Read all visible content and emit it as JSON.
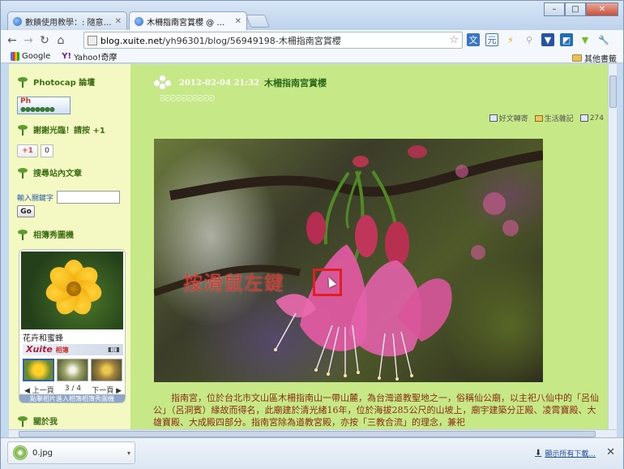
{
  "tabs": [
    {
      "label": "數饋使用教學：: 隨意窩 Xu",
      "active": false
    },
    {
      "label": "木柵指南宮賞櫻 @ 數饋使",
      "active": true
    }
  ],
  "window": {
    "minimize": "–",
    "maximize": "□",
    "close": "✕"
  },
  "toolbar": {
    "url_host": "blog.xuite.net",
    "url_path": "/yh96301/blog/56949198-木柵指南宮賞櫻"
  },
  "bookmarks": {
    "items": [
      "Google",
      "Yahoo!奇摩"
    ],
    "other": "其他書籤"
  },
  "sidebar": {
    "photocap_head": "Photocap 論壇",
    "photocap_badge": "Ph",
    "thanks_head": "謝謝光臨！請按 +1",
    "gplus_label": "+1",
    "gplus_count": "0",
    "search_head": "搜尋站內文章",
    "search_label": "輸入關鍵字",
    "go_label": "Go",
    "album_head": "相簿秀圖機",
    "album_title": "花卉和蜜蜂",
    "album_brand": "Xuite",
    "album_brand_sub": "相簿",
    "prev_label": "上一頁",
    "page_indicator": "3 / 4",
    "next_label": "下一頁",
    "album_footer": "點擊相片進入相簿相簿秀圖機",
    "about_head": "關於我"
  },
  "post": {
    "date": "2012-02-04 21:32",
    "title": "木柵指南宮賞櫻",
    "tool_share": "好文轉寄",
    "tool_category": "生活雜記",
    "views": "274",
    "photo_caption": "按滑鼠左鍵",
    "body": "指南宮，位於台北市文山區木柵指南山一帶山麓，為台灣道教聖地之一，俗稱仙公廟，以主祀八仙中的「呂仙公」（呂洞賓）緣故而得名，此廟建於清光緒16年，位於海拔285公尺的山坡上，廟宇建築分正殿、凌霄寶殿、大雄寶殿、大成殿四部分。指南宮除為道教宮殿，亦按「三教合流」的理念，兼祀"
  },
  "download": {
    "filename": "0.jpg",
    "show_all": "顯示所有下載..."
  },
  "colors": {
    "page_bg": "#c6e887",
    "sidebar_bg": "#f4f9c4",
    "body_text": "#8a2d12",
    "caption_red": "#e0332c"
  }
}
